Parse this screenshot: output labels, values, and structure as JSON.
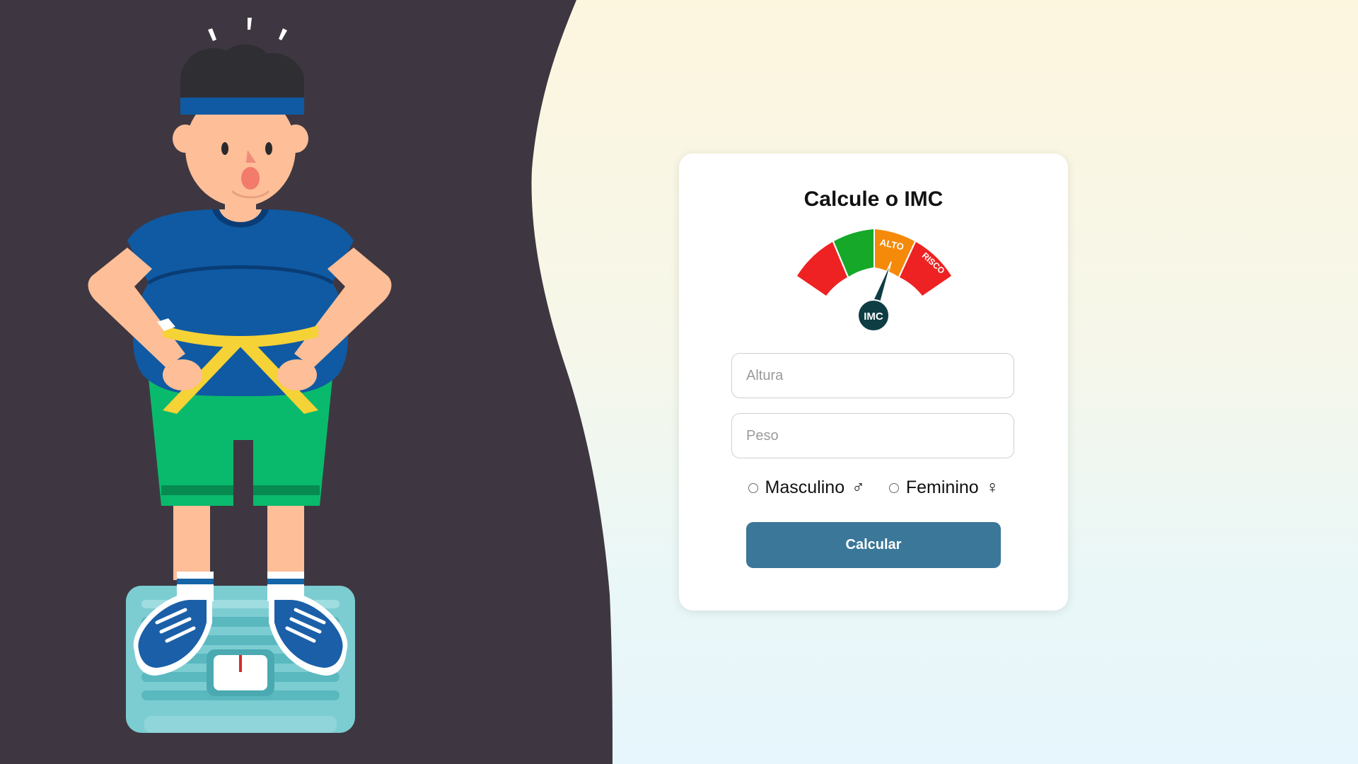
{
  "form": {
    "title": "Calcule o IMC",
    "height_placeholder": "Altura",
    "weight_placeholder": "Peso",
    "gender_options": [
      {
        "label": "Masculino",
        "symbol": "♂"
      },
      {
        "label": "Feminino",
        "symbol": "♀"
      }
    ],
    "submit_label": "Calcular"
  },
  "gauge": {
    "center_label": "IMC",
    "segment_labels": [
      "ALTO",
      "RISCO"
    ],
    "segment_colors": [
      "#ee2222",
      "#15a829",
      "#f58a0a",
      "#ee2222"
    ],
    "needle_color": "#0f3d44"
  },
  "colors": {
    "dark_panel": "#3e3741",
    "button": "#3a7799"
  }
}
